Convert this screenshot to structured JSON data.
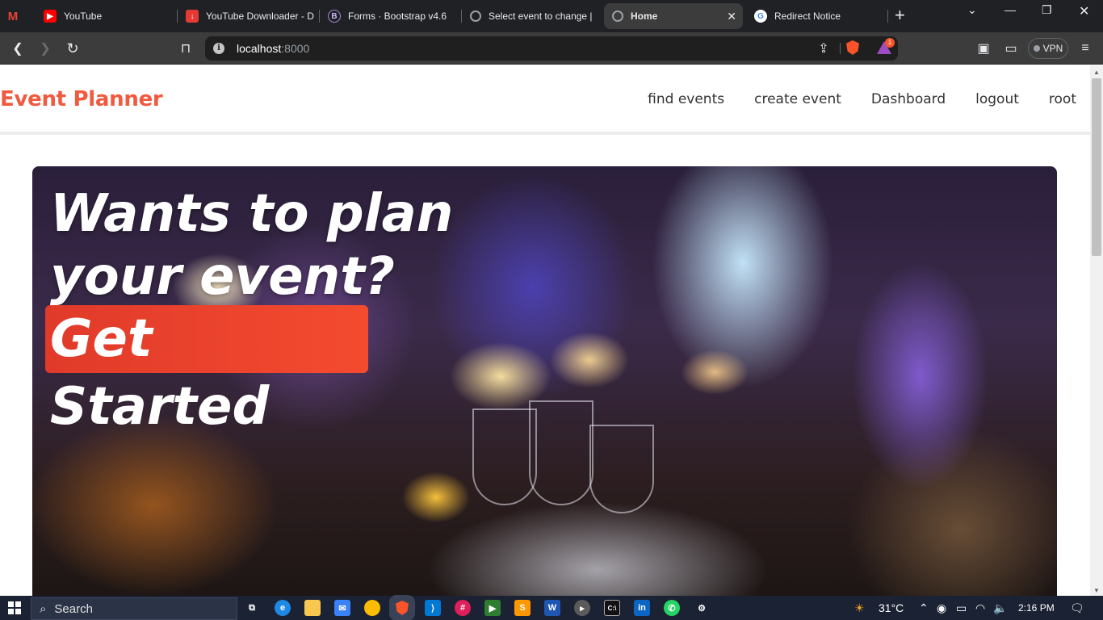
{
  "browser": {
    "tabs": [
      {
        "title": "",
        "icon": "gmail-icon",
        "color": "#ea4335"
      },
      {
        "title": "YouTube",
        "icon": "youtube-icon",
        "color": "#ff0000"
      },
      {
        "title": "YouTube Downloader - D",
        "icon": "download-icon",
        "color": "#e53935"
      },
      {
        "title": "Forms · Bootstrap v4.6",
        "icon": "bootstrap-icon",
        "color": "#7952b3"
      },
      {
        "title": "Select event to change |",
        "icon": "globe-icon",
        "color": "#9aa0a6"
      },
      {
        "title": "Home",
        "icon": "globe-icon",
        "color": "#9aa0a6"
      },
      {
        "title": "Redirect Notice",
        "icon": "google-icon",
        "color": "#4285f4"
      }
    ],
    "url_host": "localhost",
    "url_port": ":8000",
    "vpn_label": "VPN",
    "rewards_badge": "1"
  },
  "navbar": {
    "brand": "Event Planner",
    "links": [
      "find events",
      "create event",
      "Dashboard",
      "logout",
      "root"
    ]
  },
  "hero": {
    "title": "Wants to plan your event?",
    "cta": "Get Started"
  },
  "taskbar": {
    "search_label": "Search",
    "temperature": "31°C",
    "time": "2:16 PM"
  },
  "colors": {
    "brand": "#f05a3f",
    "cta": "#e8412c",
    "taskbar": "#1b2233",
    "browser_frame": "#202124"
  }
}
